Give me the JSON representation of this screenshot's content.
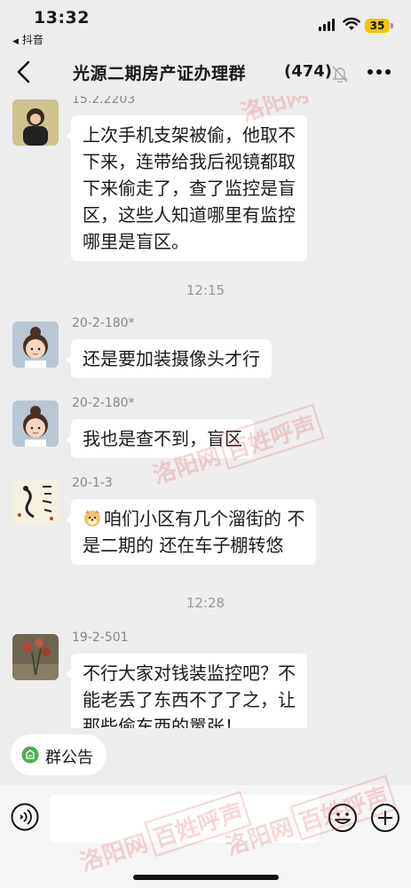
{
  "status_bar": {
    "time": "13:32",
    "back_app": "抖音",
    "battery": "35"
  },
  "nav": {
    "title": "光源二期房产证办理群",
    "member_count": "(474)"
  },
  "messages": [
    {
      "sender": "15.2.2203",
      "lines": [
        "上次手机支架被偷，他取不",
        "下来，连带给我后视镜都取",
        "下来偷走了，查了监控是盲",
        "区，这些人知道哪里有监控",
        "哪里是盲区。"
      ]
    },
    {
      "sender": "20-2-180*",
      "lines": [
        "还是要加装摄像头才行"
      ]
    },
    {
      "sender": "20-2-180*",
      "lines": [
        "我也是查不到，盲区"
      ]
    },
    {
      "sender": "20-1-3",
      "lines": [
        "咱们小区有几个溜街的 不",
        "是二期的 还在车子棚转悠"
      ]
    },
    {
      "sender": "19-2-501",
      "lines": [
        "不行大家对钱装监控吧？不",
        "能老丢了东西不了了之，让",
        "那些偷东西的嚣张！"
      ]
    }
  ],
  "timestamps": [
    "12:15",
    "12:28"
  ],
  "announcement": {
    "label": "群公告",
    "icon": "announcement-icon"
  },
  "input_bar": {
    "placeholder": "",
    "icons": [
      "voice-icon",
      "emoji-icon",
      "plus-icon"
    ]
  },
  "watermark": {
    "script": "洛阳网",
    "boxed": "百姓呼声"
  },
  "colors": {
    "background": "#ededed",
    "bubble": "#ffffff",
    "watermark": "#e14646",
    "battery": "#f2c500",
    "announce_icon": "#4caf50"
  }
}
